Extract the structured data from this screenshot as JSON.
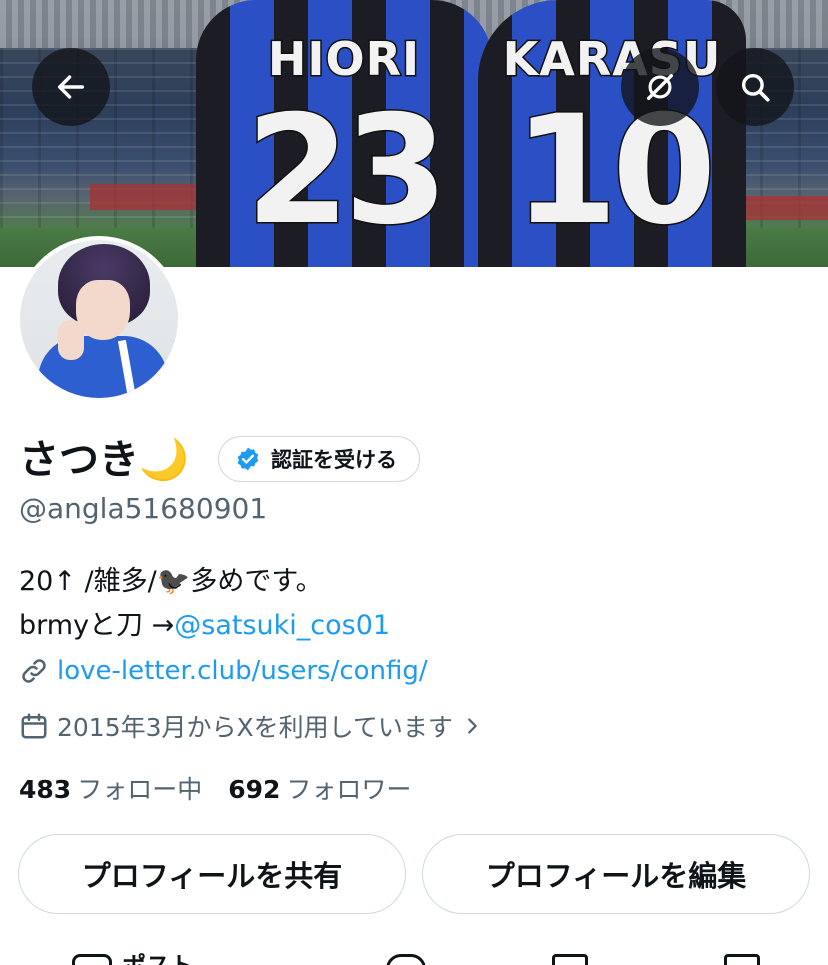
{
  "header": {
    "back_icon": "arrow-left-icon",
    "grok_icon": "grok-icon",
    "search_icon": "search-icon",
    "banner": {
      "jersey_1": {
        "name": "HIORI",
        "number": "23"
      },
      "jersey_2": {
        "name": "KARASU",
        "number": "10"
      }
    }
  },
  "profile": {
    "display_name": "さつき🌙",
    "get_verified_label": "認証を受ける",
    "verified_badge_color": "#1d9bf0",
    "handle": "@angla51680901",
    "bio_line1": "20↑ /雑多/🐦‍⬛多めです。",
    "bio_line2_prefix": "brmyと刀 →",
    "bio_line2_mention": "@satsuki_cos01",
    "link_url": "love-letter.club/users/config/",
    "joined_text": "2015年3月からXを利用しています",
    "following_count": "483",
    "following_label": "フォロー中",
    "followers_count": "692",
    "followers_label": "フォロワー"
  },
  "actions": {
    "share_label": "プロフィールを共有",
    "edit_label": "プロフィールを編集"
  },
  "tabs": [
    {
      "label": "ポスト",
      "icon": "posts-icon"
    }
  ],
  "colors": {
    "accent": "#1d9bf0",
    "secondary_text": "#536471",
    "border": "#cfd9de"
  }
}
